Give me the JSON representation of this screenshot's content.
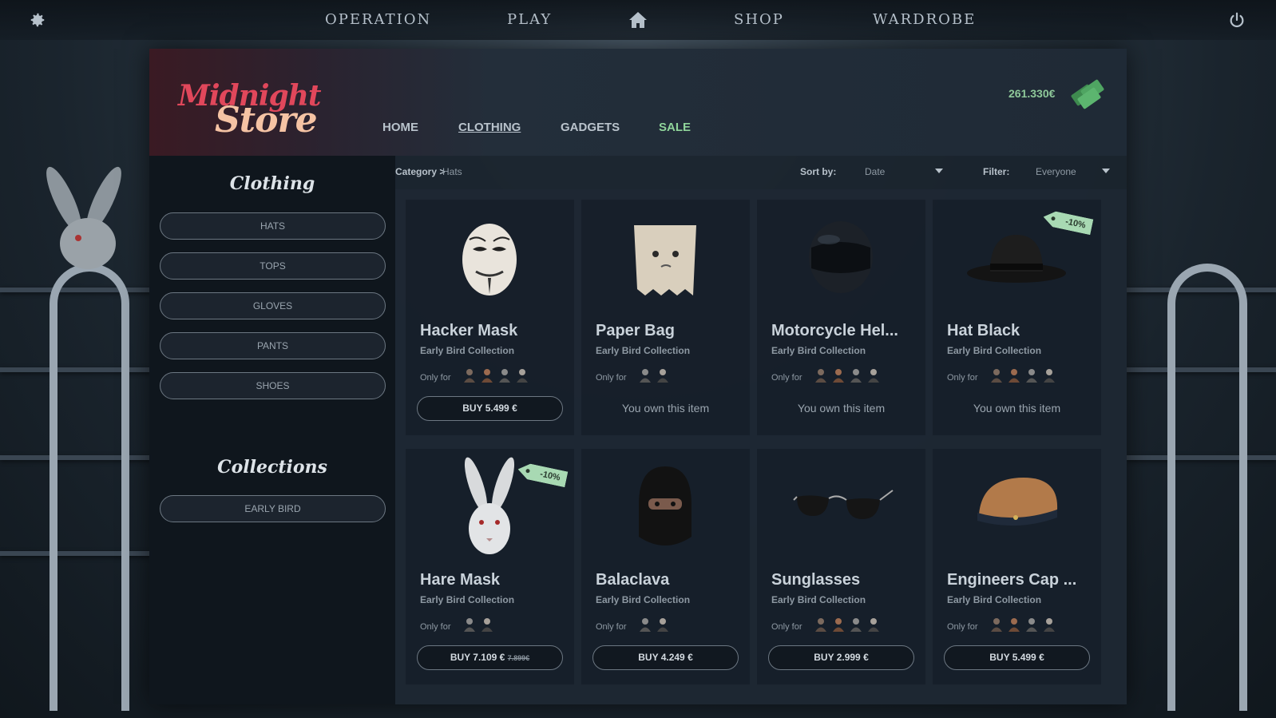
{
  "topbar": {
    "nav": [
      "OPERATION",
      "PLAY",
      "SHOP",
      "WARDROBE"
    ]
  },
  "store": {
    "logo_line1": "Midnight",
    "logo_line2": "Store",
    "tabs": [
      "HOME",
      "CLOTHING",
      "GADGETS",
      "SALE"
    ],
    "balance": "261.330€"
  },
  "sidebar": {
    "clothing_title": "Clothing",
    "categories": [
      "HATS",
      "TOPS",
      "GLOVES",
      "PANTS",
      "SHOES"
    ],
    "collections_title": "Collections",
    "collections": [
      "EARLY BIRD"
    ]
  },
  "toolbar": {
    "category_label": "Category >",
    "category_value": "Hats",
    "sort_label": "Sort by:",
    "sort_value": "Date",
    "filter_label": "Filter:",
    "filter_value": "Everyone"
  },
  "items": [
    {
      "name": "Hacker Mask",
      "collection": "Early Bird Collection",
      "only_for": "Only for",
      "avatars": 4,
      "buy": "BUY 5.499 €",
      "old_price": "",
      "owned": "",
      "discount": "",
      "icon": "hacker-mask-icon"
    },
    {
      "name": "Paper Bag",
      "collection": "Early Bird Collection",
      "only_for": "Only for",
      "avatars": 2,
      "buy": "",
      "old_price": "",
      "owned": "You own this item",
      "discount": "",
      "icon": "paper-bag-icon"
    },
    {
      "name": "Motorcycle Hel...",
      "collection": "Early Bird Collection",
      "only_for": "Only for",
      "avatars": 4,
      "buy": "",
      "old_price": "",
      "owned": "You own this item",
      "discount": "",
      "icon": "motorcycle-helmet-icon"
    },
    {
      "name": "Hat Black",
      "collection": "Early Bird Collection",
      "only_for": "Only for",
      "avatars": 4,
      "buy": "",
      "old_price": "",
      "owned": "You own this item",
      "discount": "-10%",
      "icon": "bowler-hat-icon"
    },
    {
      "name": "Hare Mask",
      "collection": "Early Bird Collection",
      "only_for": "Only for",
      "avatars": 2,
      "buy": "BUY 7.109 €",
      "old_price": "7.899€",
      "owned": "",
      "discount": "-10%",
      "icon": "hare-mask-icon"
    },
    {
      "name": "Balaclava",
      "collection": "Early Bird Collection",
      "only_for": "Only for",
      "avatars": 2,
      "buy": "BUY 4.249 €",
      "old_price": "",
      "owned": "",
      "discount": "",
      "icon": "balaclava-icon"
    },
    {
      "name": "Sunglasses",
      "collection": "Early Bird Collection",
      "only_for": "Only for",
      "avatars": 4,
      "buy": "BUY 2.999 €",
      "old_price": "",
      "owned": "",
      "discount": "",
      "icon": "sunglasses-icon"
    },
    {
      "name": "Engineers Cap ...",
      "collection": "Early Bird Collection",
      "only_for": "Only for",
      "avatars": 4,
      "buy": "BUY 5.499 €",
      "old_price": "",
      "owned": "",
      "discount": "",
      "icon": "engineers-cap-icon"
    }
  ],
  "colors": {
    "sale": "#8fd49a",
    "logo_red": "#e1475b",
    "logo_peach": "#f5c3a4",
    "money": "#8fc99a",
    "discount_tag": "#a8d9b3"
  }
}
